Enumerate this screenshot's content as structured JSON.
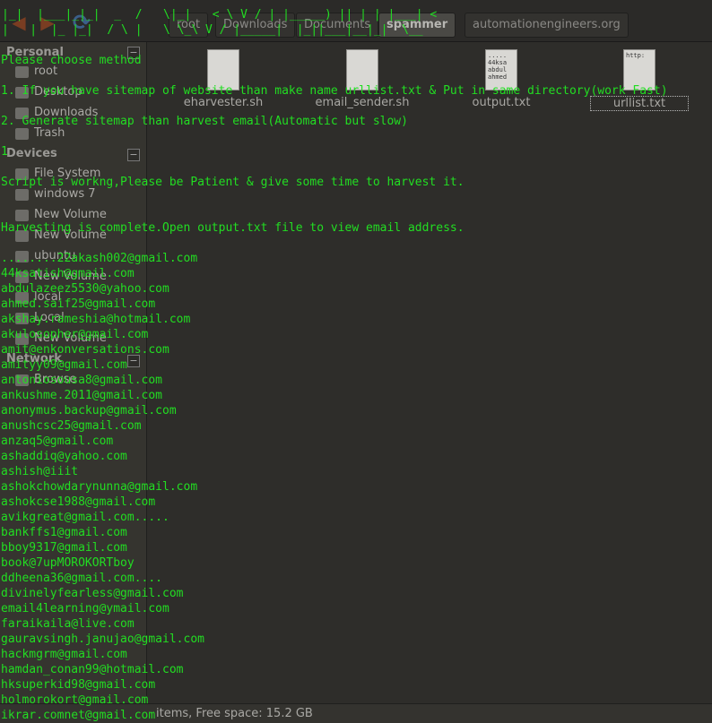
{
  "toolbar": {
    "back_icon": "back-arrow-icon",
    "forward_icon": "forward-arrow-icon",
    "reload_icon": "reload-icon",
    "breadcrumbs": [
      "root",
      "Downloads",
      "Documents",
      "spammer",
      "automationengineers.org"
    ],
    "active_breadcrumb": "spammer"
  },
  "sidebar": {
    "sections": [
      {
        "title": "Personal",
        "items": [
          "root",
          "Desktop",
          "Downloads",
          "Trash"
        ]
      },
      {
        "title": "Devices",
        "items": [
          "File System",
          "windows 7",
          "New Volume",
          "New Volume",
          "ubuntu",
          "New Volume",
          "local",
          "Local",
          "New Volume"
        ]
      },
      {
        "title": "Network",
        "items": [
          "Browse"
        ]
      }
    ]
  },
  "files": [
    {
      "name": "eharvester.sh",
      "preview": ""
    },
    {
      "name": "email_sender.sh",
      "preview": ""
    },
    {
      "name": "output.txt",
      "preview": ".....\n44ksa\nabdul\nahmed"
    },
    {
      "name": "urllist.txt",
      "preview": "http:"
    }
  ],
  "status": {
    "text": "items, Free space: 15.2 GB"
  },
  "terminal": {
    "banner_line1": "|_|  |___|_|_|  _  /   \\|_|   < \\ V / | |_____) || | | |___| <",
    "banner_line2": "|   |  |_ |_|  / \\ |   \\ \\_\\ V / |_____|  |_||___|__|_|  \\__",
    "lines": [
      "Please choose method",
      "",
      "1. If you have sitemap of website than make name urllist.txt & Put in same directory(work Fast)",
      "",
      "2. Generate sitemap than harvest email(Automatic but slow)",
      "",
      "1",
      "",
      "Script is workng,Please be Patient & give some time to harvest it.",
      "",
      "",
      "Harvesting is complete.Open output.txt file to view email address.",
      "",
      "........22akash002@gmail.com",
      "44ksatish@gmail.com",
      "abdulazeez5530@yahoo.com",
      "ahmed.saif25@gmail.com",
      "akshay.rameshia@hotmail.com",
      "akulosopher@gmail.com",
      "amit@enkonversations.com",
      "amityy09@gmail.com",
      "antoniosousa8@gmail.com",
      "ankushme.2011@gmail.com",
      "anonymus.backup@gmail.com",
      "anushcsc25@gmail.com",
      "anzaq5@gmail.com",
      "ashaddiq@yahoo.com",
      "ashish@iiit",
      "ashokchowdarynunna@gmail.com",
      "ashokcse1988@gmail.com",
      "avikgreat@gmail.com.....",
      "bankffs1@gmail.com",
      "bboy9317@gmail.com",
      "book@7upMOROKORTboy",
      "ddheena36@gmail.com....",
      "divinelyfearless@gmail.com",
      "email4learning@ymail.com",
      "faraikaila@live.com",
      "gauravsingh.janujao@gmail.com",
      "hackmgrm@gmail.com",
      "hamdan_conan99@hotmail.com",
      "hksuperkid98@gmail.com",
      "holmorokort@gmail.com",
      "ikrar.comnet@gmail.com"
    ]
  }
}
